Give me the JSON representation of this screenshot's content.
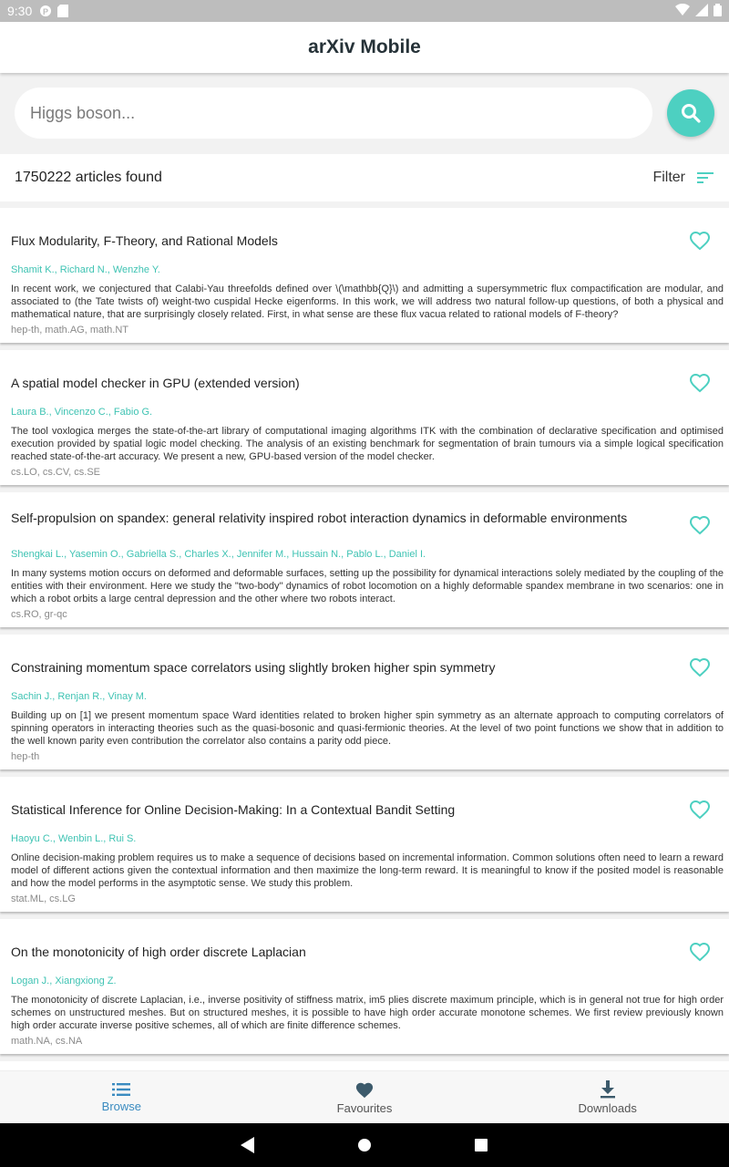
{
  "status": {
    "time": "9:30"
  },
  "app": {
    "title": "arXiv Mobile"
  },
  "search": {
    "placeholder": "Higgs boson..."
  },
  "results": {
    "count_text": "1750222 articles found",
    "filter_label": "Filter"
  },
  "colors": {
    "accent": "#4dd0c1",
    "author": "#3fc3b3",
    "nav_active": "#3a8bc0"
  },
  "articles": [
    {
      "title": "Flux Modularity, F-Theory, and Rational Models",
      "authors": "Shamit K., Richard N., Wenzhe Y.",
      "abstract": "In recent work, we conjectured that Calabi-Yau threefolds defined over \\(\\mathbb{Q}\\) and admitting a supersymmetric flux compactification are modular, and associated to (the Tate twists of) weight-two cuspidal Hecke eigenforms. In this work, we will address two natural follow-up questions, of both a physical and mathematical nature, that are surprisingly closely related. First, in what sense are these flux vacua related to rational models of F-theory?",
      "categories": "hep-th, math.AG, math.NT"
    },
    {
      "title": "A spatial model checker in GPU (extended version)",
      "authors": "Laura B., Vincenzo C., Fabio G.",
      "abstract": "The tool voxlogica merges the state-of-the-art library of computational imaging algorithms ITK with the combination of declarative specification and optimised execution provided by spatial logic model checking. The analysis of an existing benchmark for segmentation of brain tumours via a simple logical specification reached state-of-the-art accuracy. We present a new, GPU-based version of the model checker.",
      "categories": "cs.LO, cs.CV, cs.SE"
    },
    {
      "title": "Self-propulsion on spandex: general relativity inspired robot interaction dynamics in deformable environments",
      "authors": "Shengkai L., Yasemin O., Gabriella S., Charles X., Jennifer M., Hussain N., Pablo L., Daniel I.",
      "abstract": "In many systems motion occurs on deformed and deformable surfaces, setting up the possibility for dynamical interactions solely mediated by the coupling of the entities with their environment. Here we study the \"two-body\" dynamics of robot locomotion on a highly deformable spandex membrane in two scenarios: one in which a robot orbits a large central depression and the other where two robots interact.",
      "categories": "cs.RO, gr-qc"
    },
    {
      "title": "Constraining momentum space correlators using slightly broken higher spin symmetry",
      "authors": "Sachin J., Renjan R., Vinay M.",
      "abstract": "Building up on [1] we present momentum space Ward identities related to broken higher spin symmetry as an alternate approach to computing correlators of spinning operators in interacting theories such as the quasi-bosonic and quasi-fermionic theories. At the level of two point functions we show that in addition to the well known parity even contribution the correlator also contains a parity odd piece.",
      "categories": "hep-th"
    },
    {
      "title": "Statistical Inference for Online Decision-Making: In a Contextual Bandit Setting",
      "authors": "Haoyu C., Wenbin L., Rui S.",
      "abstract": "Online decision-making problem requires us to make a sequence of decisions based on incremental information. Common solutions often need to learn a reward model of different actions given the contextual information and then maximize the long-term reward. It is meaningful to know if the posited model is reasonable and how the model performs in the asymptotic sense. We study this problem.",
      "categories": "stat.ML, cs.LG"
    },
    {
      "title": "On the monotonicity of high order discrete Laplacian",
      "authors": "Logan J., Xiangxiong Z.",
      "abstract": "The monotonicity of discrete Laplacian, i.e., inverse positivity of stiffness matrix, im5 plies discrete maximum principle, which is in general not true for high order schemes on unstructured meshes. But on structured meshes, it is possible to have high order accurate monotone schemes. We first review previously known high order accurate inverse positive schemes, all of which are finite difference schemes.",
      "categories": "math.NA, cs.NA"
    }
  ],
  "nav": {
    "browse": "Browse",
    "favourites": "Favourites",
    "downloads": "Downloads"
  }
}
